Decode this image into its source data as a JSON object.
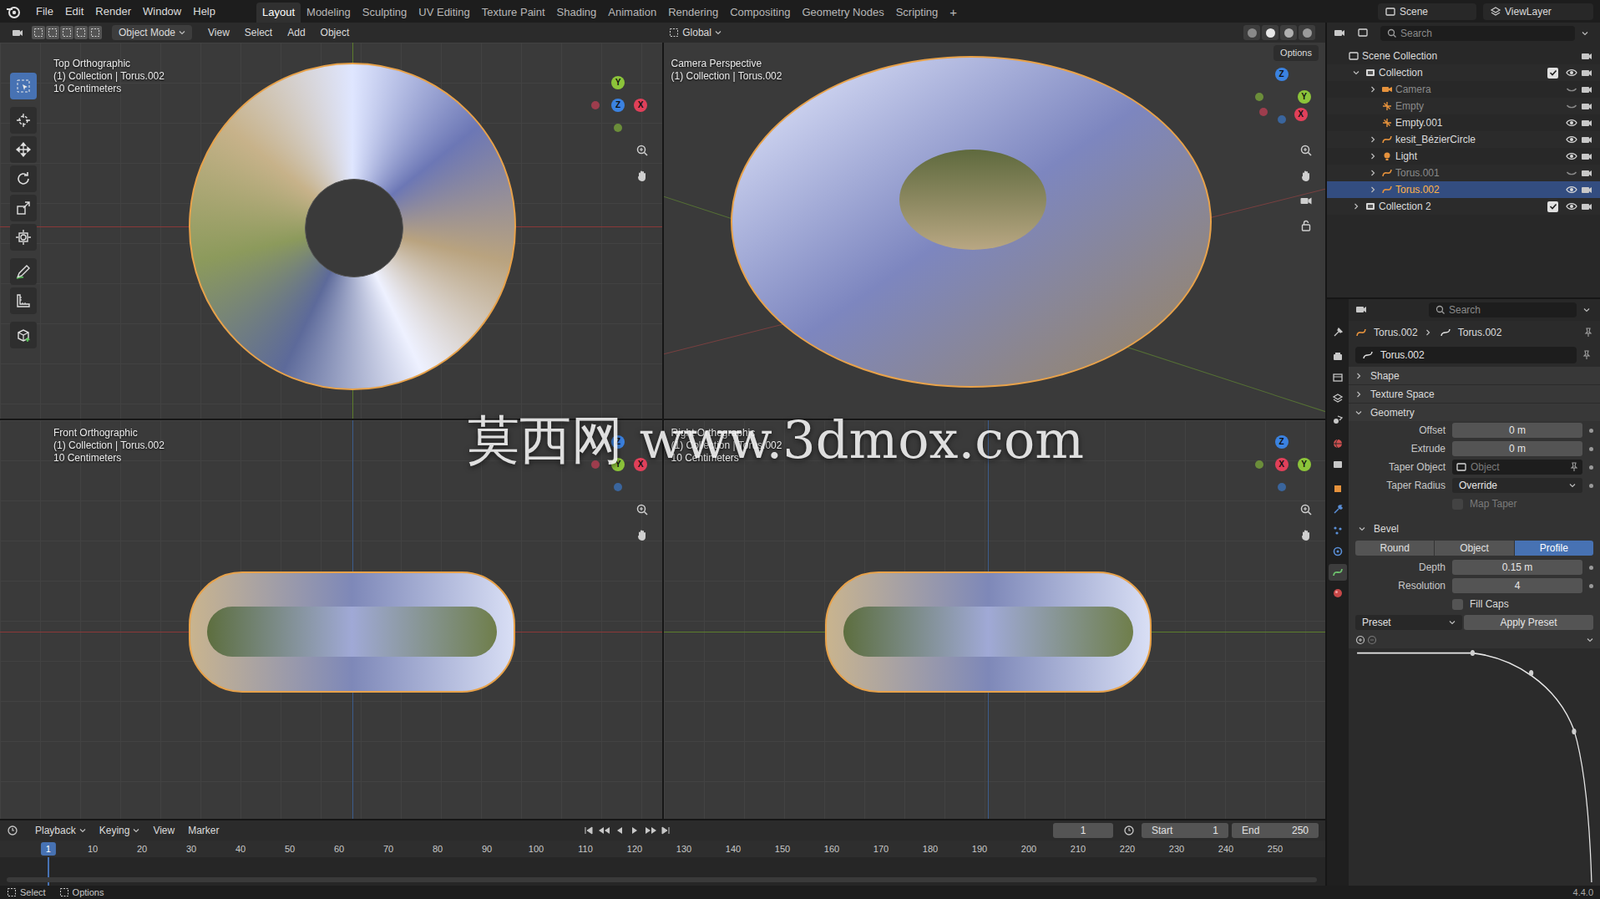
{
  "menu": [
    "File",
    "Edit",
    "Render",
    "Window",
    "Help"
  ],
  "workspaces": [
    {
      "label": "Layout",
      "selected": true
    },
    {
      "label": "Modeling",
      "selected": false
    },
    {
      "label": "Sculpting",
      "selected": false
    },
    {
      "label": "UV Editing",
      "selected": false
    },
    {
      "label": "Texture Paint",
      "selected": false
    },
    {
      "label": "Shading",
      "selected": false
    },
    {
      "label": "Animation",
      "selected": false
    },
    {
      "label": "Rendering",
      "selected": false
    },
    {
      "label": "Compositing",
      "selected": false
    },
    {
      "label": "Geometry Nodes",
      "selected": false
    },
    {
      "label": "Scripting",
      "selected": false
    }
  ],
  "add_workspace": "+",
  "scene": "Scene",
  "view_layer": "ViewLayer",
  "viewport_header": {
    "mode": "Object Mode",
    "menus": [
      "View",
      "Select",
      "Add",
      "Object"
    ],
    "orientation": "Global"
  },
  "options": "Options",
  "tools": [
    {
      "kind": "select",
      "selected": true
    },
    {
      "kind": "cursor",
      "selected": false
    },
    {
      "kind": "move",
      "selected": false
    },
    {
      "kind": "rotate",
      "selected": false
    },
    {
      "kind": "scale",
      "selected": false
    },
    {
      "kind": "transform",
      "selected": false
    },
    {
      "kind": "annotate",
      "selected": false
    },
    {
      "kind": "measure",
      "selected": false
    },
    {
      "kind": "add",
      "selected": false
    }
  ],
  "viewports": [
    {
      "view": "Top Orthographic",
      "info": "(1) Collection | Torus.002",
      "scale": "10 Centimeters",
      "kind": "ring",
      "gizmo": [
        {
          "label": "Y",
          "dir": "up",
          "color": "#8cc43a"
        },
        {
          "label": "Z",
          "dir": "center",
          "color": "#3b82e0"
        },
        {
          "label": "X",
          "dir": "right",
          "color": "#e0405a"
        }
      ]
    },
    {
      "view": "Camera Perspective",
      "info": "(1) Collection | Torus.002",
      "kind": "ellipse",
      "gizmo": [
        {
          "label": "Z",
          "dir": "up",
          "color": "#3b82e0"
        },
        {
          "label": "Y",
          "dir": "right",
          "color": "#8cc43a"
        },
        {
          "label": "X",
          "dir": "downright",
          "color": "#e0405a"
        }
      ]
    },
    {
      "view": "Front Orthographic",
      "info": "(1) Collection | Torus.002",
      "scale": "10 Centimeters",
      "kind": "pill",
      "gizmo": [
        {
          "label": "Z",
          "dir": "up",
          "color": "#3b82e0"
        },
        {
          "label": "Y",
          "dir": "center",
          "color": "#8cc43a"
        },
        {
          "label": "X",
          "dir": "right",
          "color": "#e0405a"
        }
      ]
    },
    {
      "view": "Right Orthographic",
      "info": "(1) Collection | Torus.002",
      "scale": "10 Centimeters",
      "kind": "pill",
      "gizmo": [
        {
          "label": "Z",
          "dir": "up",
          "color": "#3b82e0"
        },
        {
          "label": "X",
          "dir": "center",
          "color": "#e0405a"
        },
        {
          "label": "Y",
          "dir": "right",
          "color": "#8cc43a"
        }
      ]
    }
  ],
  "watermark": "莫西网 www.3dmox.com",
  "outliner": {
    "search": "Search",
    "items": [
      {
        "name": "Scene Collection",
        "depth": 0,
        "arrow": "none",
        "kind": "scene",
        "visible": true,
        "selected": false
      },
      {
        "name": "Collection",
        "depth": 1,
        "arrow": "expanded",
        "kind": "collection",
        "checked": true,
        "visible": true,
        "selected": false
      },
      {
        "name": "Camera",
        "depth": 2,
        "arrow": "collapsed",
        "kind": "camera",
        "visible": false,
        "selected": false
      },
      {
        "name": "Empty",
        "depth": 2,
        "arrow": "none",
        "kind": "empty",
        "visible": false,
        "selected": false
      },
      {
        "name": "Empty.001",
        "depth": 2,
        "arrow": "none",
        "kind": "empty",
        "visible": true,
        "selected": false
      },
      {
        "name": "kesit_BézierCircle",
        "depth": 2,
        "arrow": "collapsed",
        "kind": "curve",
        "visible": true,
        "selected": false
      },
      {
        "name": "Light",
        "depth": 2,
        "arrow": "collapsed",
        "kind": "light",
        "visible": true,
        "selected": false
      },
      {
        "name": "Torus.001",
        "depth": 2,
        "arrow": "collapsed",
        "kind": "curve",
        "visible": false,
        "selected": false
      },
      {
        "name": "Torus.002",
        "depth": 2,
        "arrow": "collapsed",
        "kind": "curve",
        "visible": true,
        "selected": true
      },
      {
        "name": "Collection 2",
        "depth": 1,
        "arrow": "collapsed",
        "kind": "collection",
        "checked": true,
        "visible": true,
        "selected": false
      }
    ]
  },
  "properties": {
    "search": "Search",
    "tabs": [
      {
        "kind": "tool",
        "selected": false
      },
      {
        "kind": "render",
        "selected": false
      },
      {
        "kind": "output",
        "selected": false
      },
      {
        "kind": "view_layer",
        "selected": false
      },
      {
        "kind": "scene",
        "selected": false
      },
      {
        "kind": "world",
        "selected": false
      },
      {
        "kind": "collection",
        "selected": false
      },
      {
        "kind": "object",
        "selected": false
      },
      {
        "kind": "modifiers",
        "selected": false
      },
      {
        "kind": "particles",
        "selected": false
      },
      {
        "kind": "physics",
        "selected": false
      },
      {
        "kind": "data",
        "selected": true
      },
      {
        "kind": "material",
        "selected": false
      }
    ],
    "breadcrumb": [
      "Torus.002",
      "Torus.002"
    ],
    "datablock": "Torus.002",
    "panels": [
      {
        "label": "Shape",
        "expanded": false
      },
      {
        "label": "Texture Space",
        "expanded": false
      },
      {
        "label": "Geometry",
        "expanded": true
      }
    ],
    "geometry": [
      {
        "label": "Offset",
        "kind": "number",
        "value": "0 m"
      },
      {
        "label": "Extrude",
        "kind": "number",
        "value": "0 m"
      },
      {
        "label": "Taper Object",
        "kind": "object",
        "placeholder": "Object"
      },
      {
        "label": "Taper Radius",
        "kind": "dropdown",
        "value": "Override"
      },
      {
        "label": "Map Taper",
        "kind": "checkbox",
        "checked": false,
        "disabled": true
      }
    ],
    "bevel": {
      "label": "Bevel",
      "expanded": true,
      "modes": [
        {
          "label": "Round",
          "selected": false
        },
        {
          "label": "Object",
          "selected": false
        },
        {
          "label": "Profile",
          "selected": true
        }
      ],
      "fields": [
        {
          "label": "Depth",
          "kind": "number",
          "value": "0.15 m"
        },
        {
          "label": "Resolution",
          "kind": "number",
          "value": "4"
        },
        {
          "label": "Fill Caps",
          "kind": "checkbox",
          "checked": false,
          "disabled": false
        }
      ],
      "preset": "Preset",
      "apply": "Apply Preset"
    }
  },
  "timeline": {
    "menus": [
      "Playback",
      "Keying",
      "View",
      "Marker"
    ],
    "frame": "1",
    "start_label": "Start",
    "start": "1",
    "end_label": "End",
    "end": "250",
    "current": "1",
    "ticks": [
      "10",
      "20",
      "30",
      "40",
      "50",
      "60",
      "70",
      "80",
      "90",
      "100",
      "110",
      "120",
      "130",
      "140",
      "150",
      "160",
      "170",
      "180",
      "190",
      "200",
      "210",
      "220",
      "230",
      "240",
      "250"
    ]
  },
  "status": {
    "items": [
      "Select",
      "Options"
    ],
    "version": "4.4.0"
  }
}
